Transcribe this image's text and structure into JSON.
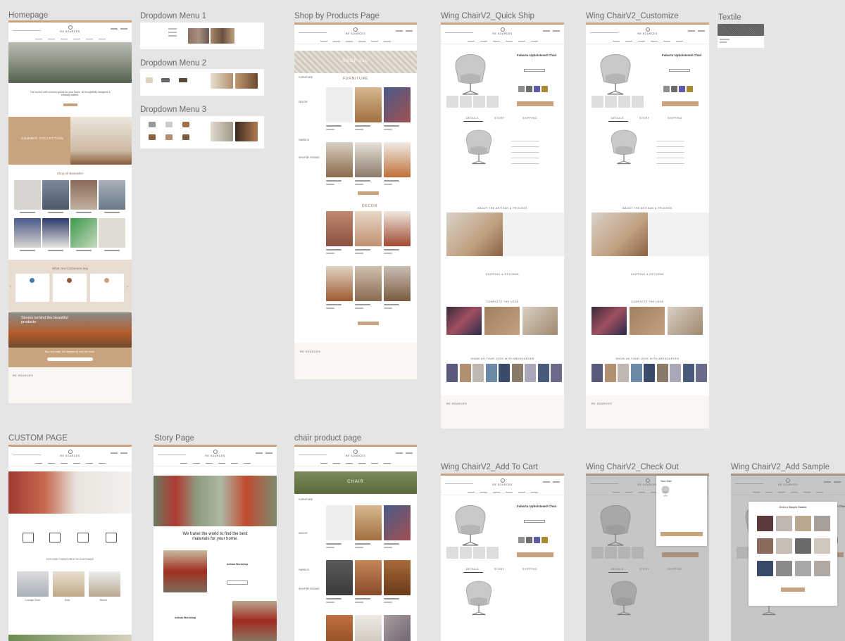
{
  "frames": {
    "homepage": "Homepage",
    "dropdown1": "Dropdown Menu 1",
    "dropdown2": "Dropdown Menu 2",
    "dropdown3": "Dropdown Menu 3",
    "shop_products": "Shop by Products Page",
    "quick_ship": "Wing ChairV2_Quick Ship",
    "customize": "Wing ChairV2_Customize",
    "textile": "Textile",
    "custom_page": "CUSTOM PAGE",
    "story_page": "Story Page",
    "chair_product": "chair product page",
    "add_to_cart": "Wing ChairV2_Add To Cart",
    "check_out": "Wing ChairV2_Check Out",
    "add_sample": "Wing ChairV2_Add Sample"
  },
  "brand": "RE SOURCES",
  "homepage": {
    "tagline": "The world's well sourced goods for your home, all thoughtfully designed & ethically crafted.",
    "collection": "SUMMER COLLECTION",
    "shop_all": "Shop All Bestseller",
    "customer": "What Our Customers Say",
    "stories": "Stories behind the beautiful products",
    "artisans": "Buy and make 100 artisans all over the world."
  },
  "shop": {
    "banner": "SHOP ALL",
    "furniture": "FURNITURE",
    "decor": "DECOR",
    "filters": [
      "FURNITURE",
      "DECOR",
      "FABRICS",
      "SHOP BY ROOMS"
    ]
  },
  "chair_page_banner": "CHAIR",
  "product": {
    "name": "Fabarta Upholstered Chair",
    "tabs": [
      "DETAILS",
      "STORY",
      "SHIPPING"
    ],
    "about": "ABOUT THE ARTISAN & PROCESS",
    "shipping": "SHIPPING & RETURNS",
    "complete": "COMPLETE THE LOOK",
    "share": "SHOW US YOUR LOOK WITH #RESOURCES",
    "cart_title": "Your Cart"
  },
  "story": {
    "headline": "We travel the world to find the best materials for your home.",
    "workshop": "Artisan Workshop"
  },
  "custom": {
    "heading": "EXPLORE FURNITURES TO CUSTOMIZE",
    "labels": [
      "Lounge Chair",
      "Sofa",
      "Bench"
    ]
  },
  "sample": {
    "heading": "Order a Sample Swatch"
  },
  "colors": {
    "accent": "#c9a27e",
    "canvas": "#e5e5e5"
  }
}
